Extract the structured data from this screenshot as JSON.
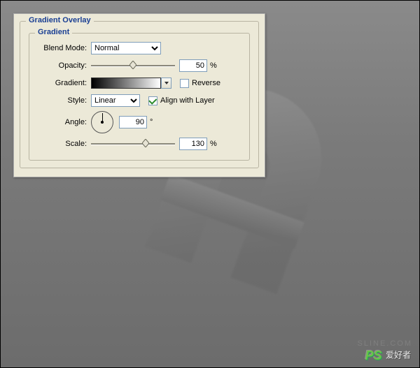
{
  "panel": {
    "title": "Gradient Overlay",
    "group": {
      "title": "Gradient",
      "blend_mode": {
        "label": "Blend Mode:",
        "value": "Normal"
      },
      "opacity": {
        "label": "Opacity:",
        "value": "50",
        "unit": "%",
        "slider_pct": 50
      },
      "gradient": {
        "label": "Gradient:",
        "reverse_label": "Reverse",
        "reverse_checked": false
      },
      "style": {
        "label": "Style:",
        "value": "Linear",
        "align_label": "Align with Layer",
        "align_checked": true
      },
      "angle": {
        "label": "Angle:",
        "value": "90",
        "unit": "°"
      },
      "scale": {
        "label": "Scale:",
        "value": "130",
        "unit": "%",
        "slider_pct": 65
      }
    }
  },
  "watermark": {
    "prefix": "PS",
    "text": " 爱好者"
  },
  "url_faint": "SLINE.COM"
}
